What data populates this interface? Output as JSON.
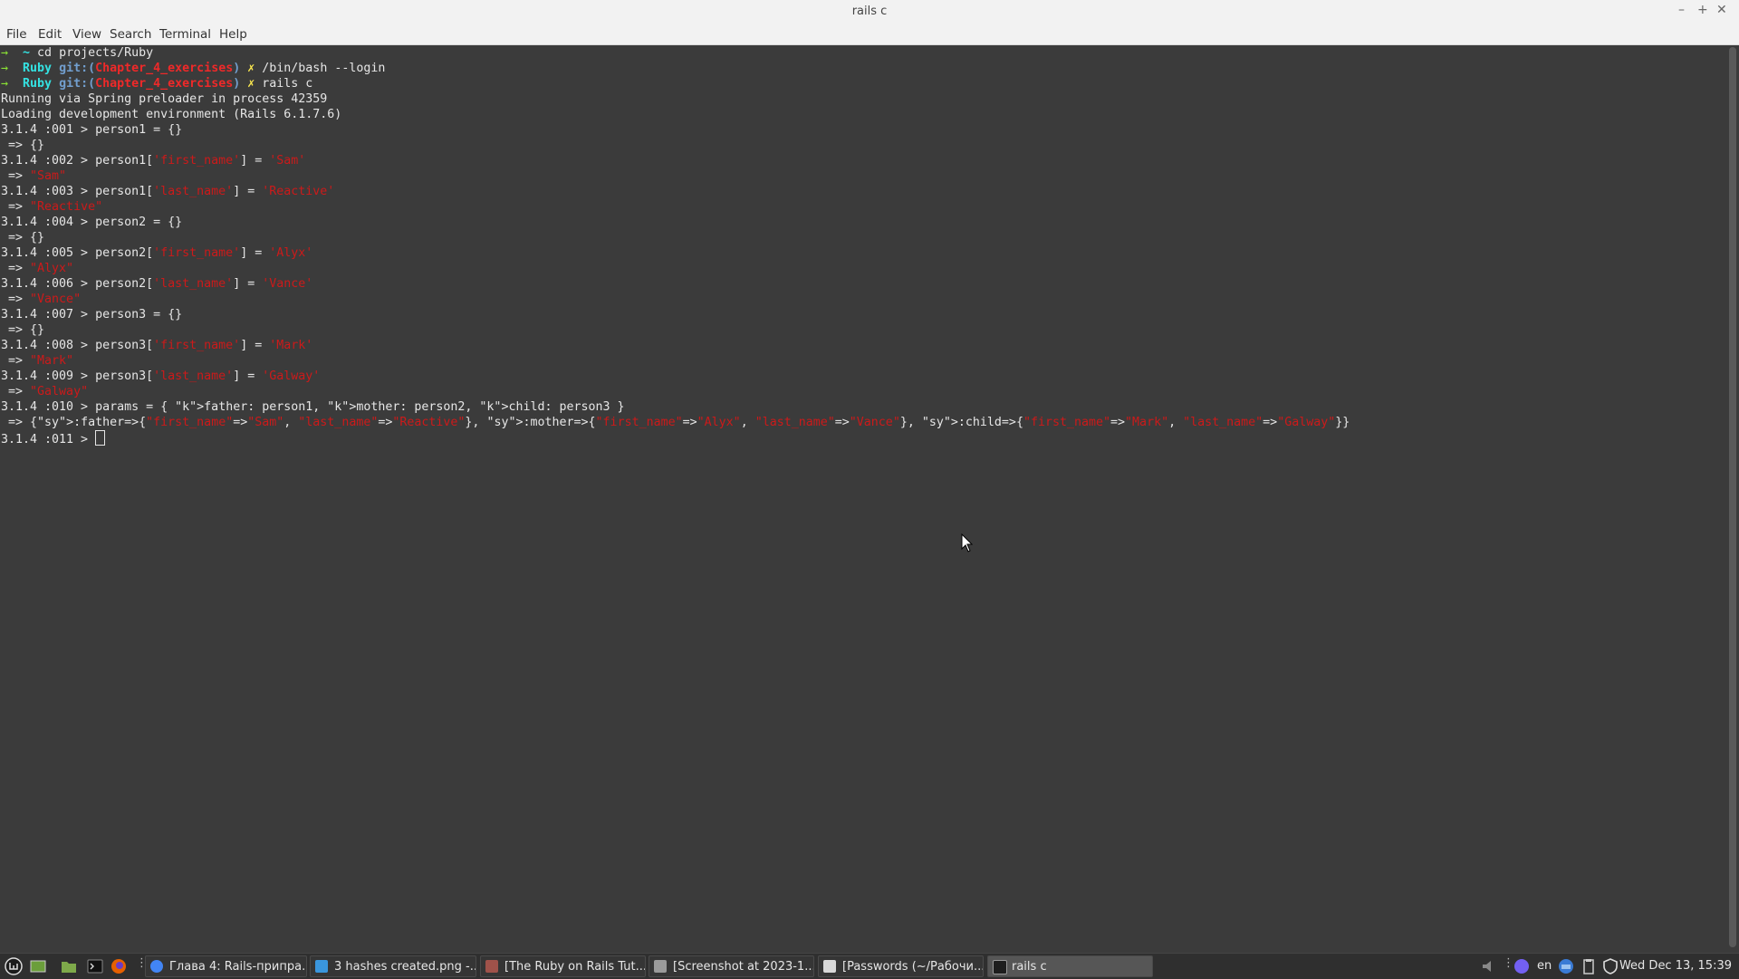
{
  "window": {
    "title": "rails c",
    "minimize": "–",
    "maximize": "+",
    "close": "✕"
  },
  "menu": [
    "File",
    "Edit",
    "View",
    "Search",
    "Terminal",
    "Help"
  ],
  "terminal": {
    "lines": [
      [
        "→  ~ cd projects/Ruby"
      ],
      [
        "→  Ruby git:(Chapter_4_exercises) ✗ /bin/bash --login"
      ],
      [
        "→  Ruby git:(Chapter_4_exercises) ✗ rails c"
      ],
      [
        "Running via Spring preloader in process 42359"
      ],
      [
        "Loading development environment (Rails 6.1.7.6)"
      ],
      [
        "3.1.4 :001 > person1 = {}"
      ],
      [
        " => {}"
      ],
      [
        "3.1.4 :002 > person1['first_name'] = 'Sam'"
      ],
      [
        " => \"Sam\""
      ],
      [
        "3.1.4 :003 > person1['last_name'] = 'Reactive'"
      ],
      [
        " => \"Reactive\""
      ],
      [
        "3.1.4 :004 > person2 = {}"
      ],
      [
        " => {}"
      ],
      [
        "3.1.4 :005 > person2['first_name'] = 'Alyx'"
      ],
      [
        " => \"Alyx\""
      ],
      [
        "3.1.4 :006 > person2['last_name'] = 'Vance'"
      ],
      [
        " => \"Vance\""
      ],
      [
        "3.1.4 :007 > person3 = {}"
      ],
      [
        " => {}"
      ],
      [
        "3.1.4 :008 > person3['first_name'] = 'Mark'"
      ],
      [
        " => \"Mark\""
      ],
      [
        "3.1.4 :009 > person3['last_name'] = 'Galway'"
      ],
      [
        " => \"Galway\""
      ],
      [
        "3.1.4 :010 > params = { father: person1, mother: person2, child: person3 }"
      ],
      [
        " => {:father=>{\"first_name\"=>\"Sam\", \"last_name\"=>\"Reactive\"}, :mother=>{\"first_name\"=>\"Alyx\", \"last_name\"=>\"Vance\"}, :child=>{\"first_name\"=>\"Mark\", \"last_name\"=>\"Galway\"}}"
      ],
      [
        "3.1.4 :011 > "
      ]
    ]
  },
  "taskbar": {
    "tasks": [
      {
        "label": "Глава 4: Rails-припра...",
        "icon": "chrome-icon",
        "color": "#4285f4"
      },
      {
        "label": "3 hashes created.png -...",
        "icon": "vscode-icon",
        "color": "#3a96dd"
      },
      {
        "label": "[The Ruby on Rails Tut...",
        "icon": "book-icon",
        "color": "#a0524a"
      },
      {
        "label": "[Screenshot at 2023-1...",
        "icon": "image-viewer-icon",
        "color": "#9a9a9a"
      },
      {
        "label": "[Passwords (~/Рабочи...",
        "icon": "text-editor-icon",
        "color": "#d8d8d8"
      },
      {
        "label": "rails c",
        "icon": "terminal-icon",
        "color": "#1e1e1e"
      }
    ],
    "language": "en",
    "clock": "Wed Dec 13, 15:39"
  },
  "colors": {
    "terminal_bg": "#3b3b3b",
    "prompt_arrow": "#8ae234",
    "string": "#cc1a1a",
    "symbol": "#d7a41a"
  }
}
